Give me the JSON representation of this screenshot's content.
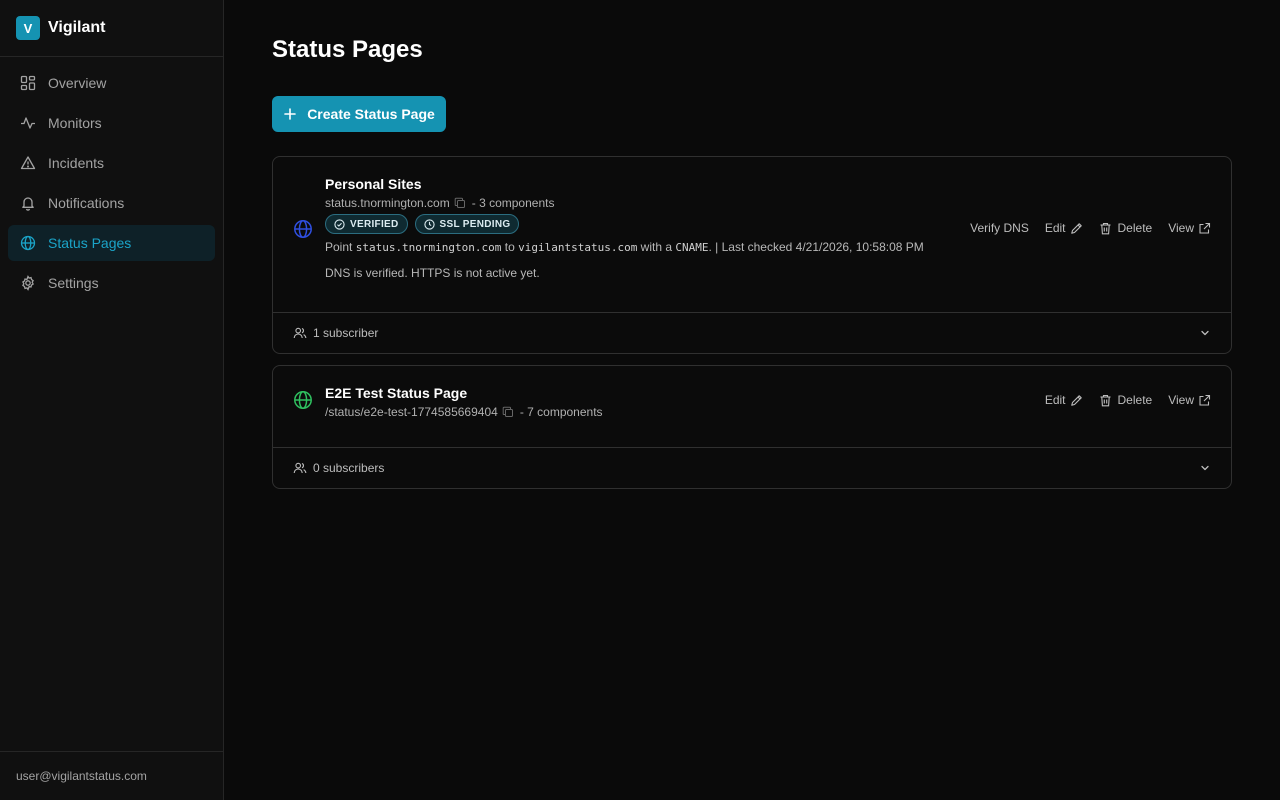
{
  "brand": {
    "initial": "V",
    "name": "Vigilant"
  },
  "nav": [
    {
      "label": "Overview",
      "icon": "grid-icon"
    },
    {
      "label": "Monitors",
      "icon": "activity-icon"
    },
    {
      "label": "Incidents",
      "icon": "alert-triangle-icon"
    },
    {
      "label": "Notifications",
      "icon": "bell-icon"
    },
    {
      "label": "Status Pages",
      "icon": "globe-icon",
      "active": true
    },
    {
      "label": "Settings",
      "icon": "gear-icon"
    }
  ],
  "user_email": "user@vigilantstatus.com",
  "page_title": "Status Pages",
  "create_button": "Create Status Page",
  "colors": {
    "accent": "#1593b2",
    "globe_blue": "#2f4fe0",
    "globe_green": "#2fbf5f"
  },
  "cards": [
    {
      "name": "Personal Sites",
      "url": "status.tnormington.com",
      "components": "- 3 components",
      "badges": [
        "VERIFIED",
        "SSL PENDING"
      ],
      "dns": {
        "prefix": "Point",
        "host": "status.tnormington.com",
        "to": "to",
        "target": "vigilantstatus.com",
        "with": "with a",
        "record": "CNAME",
        "suffix": ". | Last checked 4/21/2026, 10:58:08 PM"
      },
      "note": "DNS is verified. HTTPS is not active yet.",
      "actions": {
        "verify": "Verify DNS",
        "edit": "Edit",
        "delete": "Delete",
        "view": "View"
      },
      "subscribers": "1 subscriber"
    },
    {
      "name": "E2E Test Status Page",
      "url": "/status/e2e-test-1774585669404",
      "components": "- 7 components",
      "actions": {
        "edit": "Edit",
        "delete": "Delete",
        "view": "View"
      },
      "subscribers": "0 subscribers"
    }
  ]
}
